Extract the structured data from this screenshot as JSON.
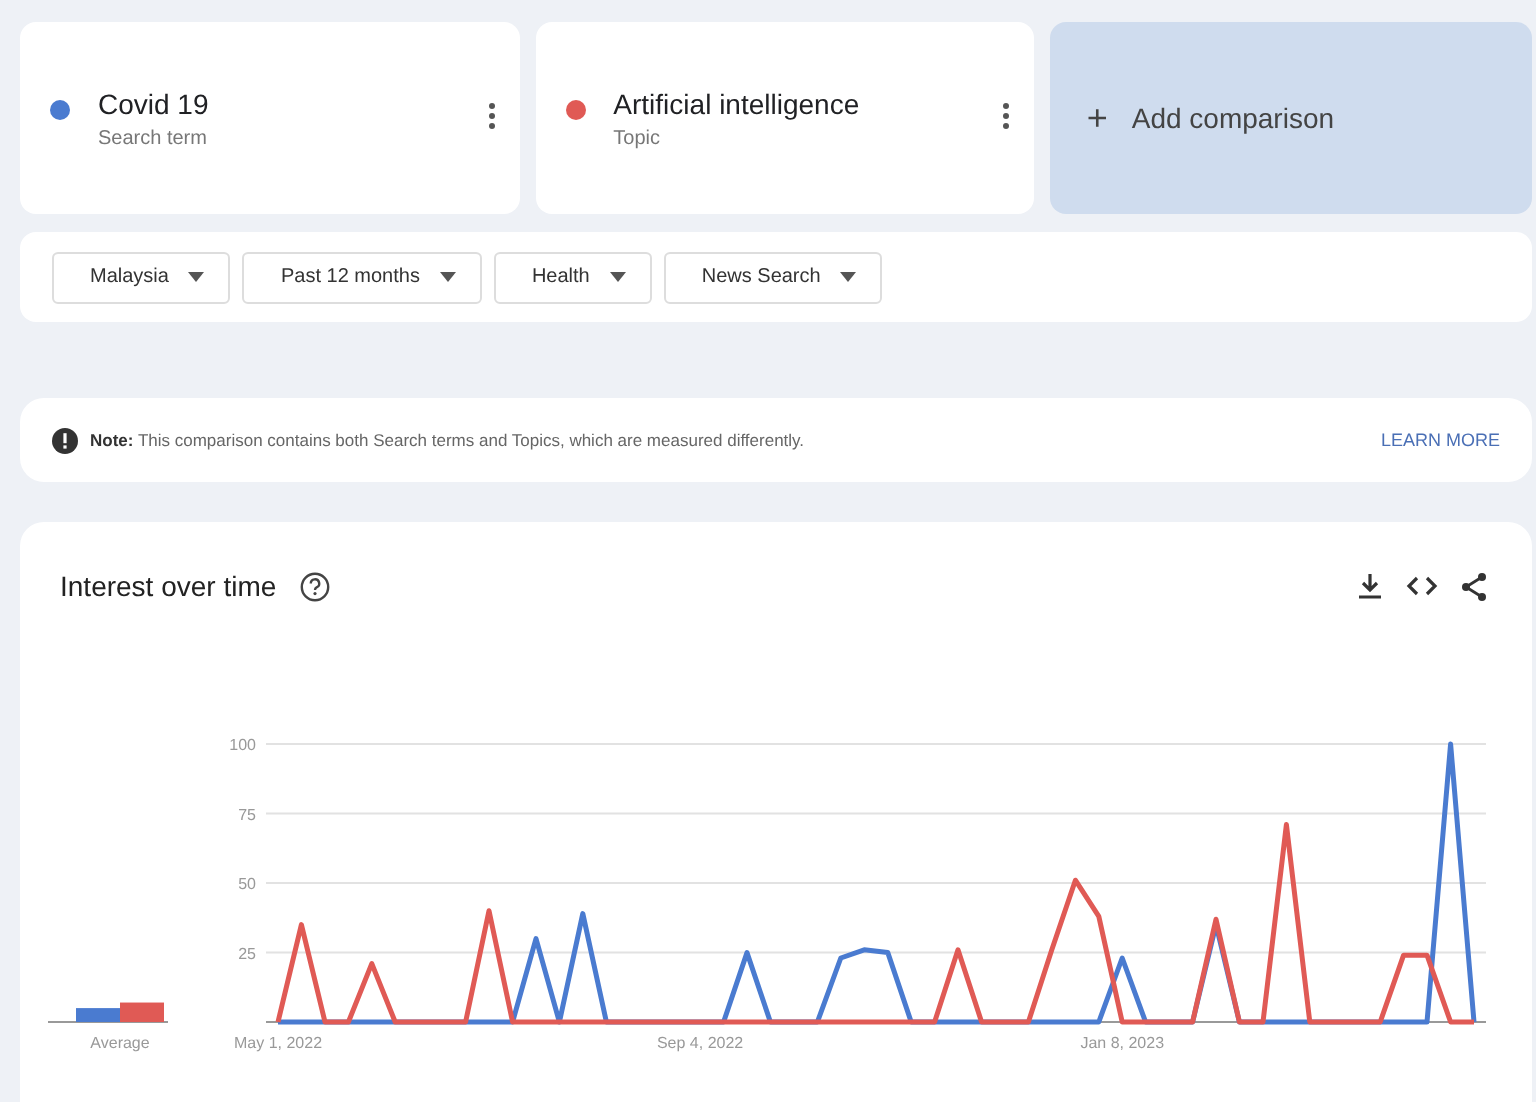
{
  "terms": [
    {
      "name": "Covid 19",
      "type": "Search term",
      "color": "#4a7bd0"
    },
    {
      "name": "Artificial intelligence",
      "type": "Topic",
      "color": "#e05a55"
    }
  ],
  "add_comparison": {
    "icon": "+",
    "label": "Add comparison"
  },
  "filters": [
    {
      "label": "Malaysia"
    },
    {
      "label": "Past 12 months"
    },
    {
      "label": "Health"
    },
    {
      "label": "News Search"
    }
  ],
  "note": {
    "text": "**Note:** This comparison contains both Search terms and Topics, which are measured differently.",
    "link": "LEARN MORE"
  },
  "interest": {
    "title": "Interest over time",
    "average": {
      "chart_data": {
        "type": "bar",
        "categories": [
          "Average"
        ],
        "ylim": [
          0,
          100
        ],
        "series": [
          {
            "color": "#4a7bd0",
            "values": [
              5
            ]
          },
          {
            "color": "#e05a55",
            "values": [
              7
            ]
          }
        ]
      }
    },
    "chart_data": {
      "type": "line",
      "ylim": [
        0,
        100
      ],
      "yticks": [
        25,
        50,
        75,
        100
      ],
      "categories": [
        "May 1, 2022",
        null,
        null,
        null,
        null,
        null,
        null,
        null,
        null,
        null,
        null,
        null,
        null,
        null,
        null,
        null,
        null,
        null,
        "Sep 4, 2022",
        null,
        null,
        null,
        null,
        null,
        null,
        null,
        null,
        null,
        null,
        null,
        null,
        null,
        null,
        null,
        null,
        null,
        "Jan 8, 2023",
        null,
        null,
        null,
        null,
        null,
        null,
        null,
        null,
        null,
        null,
        null,
        null,
        null,
        null,
        null
      ],
      "grid": true,
      "series": [
        {
          "color": "#4a7bd0",
          "values": [
            0,
            0,
            0,
            0,
            0,
            0,
            0,
            0,
            0,
            0,
            0,
            30,
            0,
            39,
            0,
            0,
            0,
            0,
            0,
            0,
            25,
            0,
            0,
            0,
            23,
            26,
            25,
            0,
            0,
            0,
            0,
            0,
            0,
            0,
            0,
            0,
            23,
            0,
            0,
            0,
            35,
            0,
            0,
            0,
            0,
            0,
            0,
            0,
            0,
            0,
            100,
            0
          ]
        },
        {
          "color": "#e05a55",
          "values": [
            0,
            35,
            0,
            0,
            21,
            0,
            0,
            0,
            0,
            40,
            0,
            0,
            0,
            0,
            0,
            0,
            0,
            0,
            0,
            0,
            0,
            0,
            0,
            0,
            0,
            0,
            0,
            0,
            0,
            26,
            0,
            0,
            0,
            26,
            51,
            38,
            0,
            0,
            0,
            0,
            37,
            0,
            0,
            71,
            0,
            0,
            0,
            0,
            24,
            24,
            0,
            0
          ]
        }
      ]
    }
  }
}
